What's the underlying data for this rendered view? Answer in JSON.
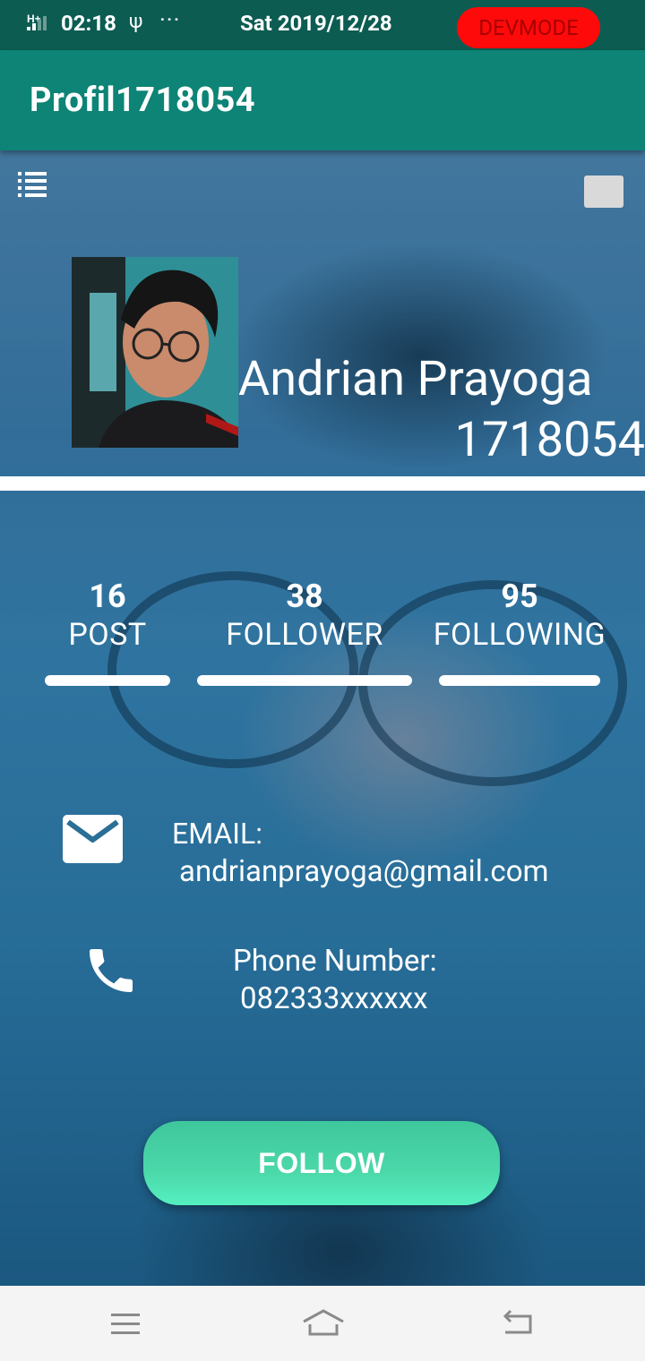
{
  "status_bar": {
    "network": "H+",
    "time": "02:18",
    "usb_symbol": "ψ",
    "more_symbol": "···",
    "date": "Sat 2019/12/28",
    "dev_badge": "DEVMODE"
  },
  "appbar": {
    "title": "Profil1718054"
  },
  "profile": {
    "name": "Andrian Prayoga",
    "id": "1718054"
  },
  "stats": [
    {
      "value": "16",
      "label": "POST"
    },
    {
      "value": "38",
      "label": "FOLLOWER"
    },
    {
      "value": "95",
      "label": "FOLLOWING"
    }
  ],
  "contact": {
    "email_label": "EMAIL:",
    "email_value": "andrianprayoga@gmail.com",
    "phone_label": "Phone Number:",
    "phone_value": "082333xxxxxx"
  },
  "follow_button": {
    "label": "FOLLOW"
  },
  "colors": {
    "status_bar": "#0c5c52",
    "appbar": "#0d8475",
    "dev_badge": "#ff0a0a",
    "follow_button": "#4bd8a9"
  },
  "icons": {
    "menu": "list-icon",
    "email": "envelope-icon",
    "phone": "phone-icon",
    "nav_menu": "hamburger-icon",
    "nav_home": "home-icon",
    "nav_back": "back-icon"
  }
}
